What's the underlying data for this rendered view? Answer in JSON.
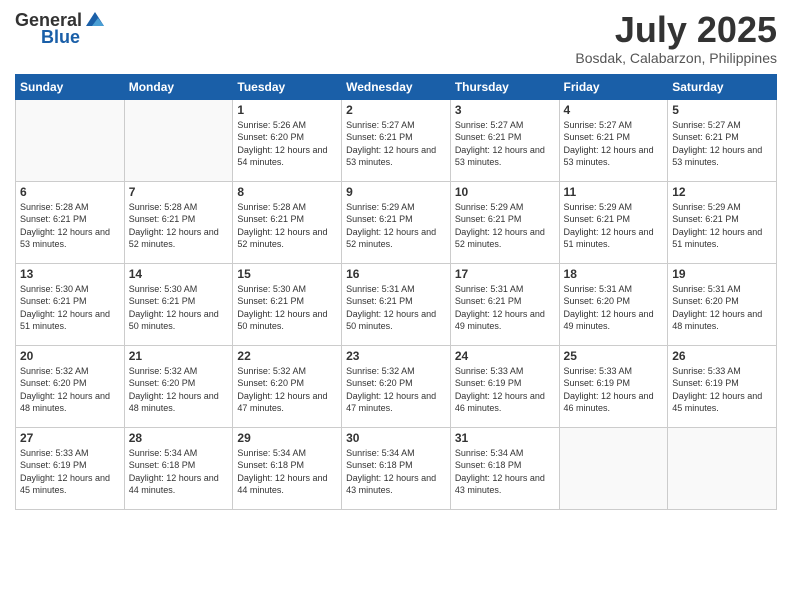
{
  "logo": {
    "general": "General",
    "blue": "Blue"
  },
  "title": "July 2025",
  "location": "Bosdak, Calabarzon, Philippines",
  "days_of_week": [
    "Sunday",
    "Monday",
    "Tuesday",
    "Wednesday",
    "Thursday",
    "Friday",
    "Saturday"
  ],
  "weeks": [
    [
      {
        "num": "",
        "info": ""
      },
      {
        "num": "",
        "info": ""
      },
      {
        "num": "1",
        "info": "Sunrise: 5:26 AM\nSunset: 6:20 PM\nDaylight: 12 hours and 54 minutes."
      },
      {
        "num": "2",
        "info": "Sunrise: 5:27 AM\nSunset: 6:21 PM\nDaylight: 12 hours and 53 minutes."
      },
      {
        "num": "3",
        "info": "Sunrise: 5:27 AM\nSunset: 6:21 PM\nDaylight: 12 hours and 53 minutes."
      },
      {
        "num": "4",
        "info": "Sunrise: 5:27 AM\nSunset: 6:21 PM\nDaylight: 12 hours and 53 minutes."
      },
      {
        "num": "5",
        "info": "Sunrise: 5:27 AM\nSunset: 6:21 PM\nDaylight: 12 hours and 53 minutes."
      }
    ],
    [
      {
        "num": "6",
        "info": "Sunrise: 5:28 AM\nSunset: 6:21 PM\nDaylight: 12 hours and 53 minutes."
      },
      {
        "num": "7",
        "info": "Sunrise: 5:28 AM\nSunset: 6:21 PM\nDaylight: 12 hours and 52 minutes."
      },
      {
        "num": "8",
        "info": "Sunrise: 5:28 AM\nSunset: 6:21 PM\nDaylight: 12 hours and 52 minutes."
      },
      {
        "num": "9",
        "info": "Sunrise: 5:29 AM\nSunset: 6:21 PM\nDaylight: 12 hours and 52 minutes."
      },
      {
        "num": "10",
        "info": "Sunrise: 5:29 AM\nSunset: 6:21 PM\nDaylight: 12 hours and 52 minutes."
      },
      {
        "num": "11",
        "info": "Sunrise: 5:29 AM\nSunset: 6:21 PM\nDaylight: 12 hours and 51 minutes."
      },
      {
        "num": "12",
        "info": "Sunrise: 5:29 AM\nSunset: 6:21 PM\nDaylight: 12 hours and 51 minutes."
      }
    ],
    [
      {
        "num": "13",
        "info": "Sunrise: 5:30 AM\nSunset: 6:21 PM\nDaylight: 12 hours and 51 minutes."
      },
      {
        "num": "14",
        "info": "Sunrise: 5:30 AM\nSunset: 6:21 PM\nDaylight: 12 hours and 50 minutes."
      },
      {
        "num": "15",
        "info": "Sunrise: 5:30 AM\nSunset: 6:21 PM\nDaylight: 12 hours and 50 minutes."
      },
      {
        "num": "16",
        "info": "Sunrise: 5:31 AM\nSunset: 6:21 PM\nDaylight: 12 hours and 50 minutes."
      },
      {
        "num": "17",
        "info": "Sunrise: 5:31 AM\nSunset: 6:21 PM\nDaylight: 12 hours and 49 minutes."
      },
      {
        "num": "18",
        "info": "Sunrise: 5:31 AM\nSunset: 6:20 PM\nDaylight: 12 hours and 49 minutes."
      },
      {
        "num": "19",
        "info": "Sunrise: 5:31 AM\nSunset: 6:20 PM\nDaylight: 12 hours and 48 minutes."
      }
    ],
    [
      {
        "num": "20",
        "info": "Sunrise: 5:32 AM\nSunset: 6:20 PM\nDaylight: 12 hours and 48 minutes."
      },
      {
        "num": "21",
        "info": "Sunrise: 5:32 AM\nSunset: 6:20 PM\nDaylight: 12 hours and 48 minutes."
      },
      {
        "num": "22",
        "info": "Sunrise: 5:32 AM\nSunset: 6:20 PM\nDaylight: 12 hours and 47 minutes."
      },
      {
        "num": "23",
        "info": "Sunrise: 5:32 AM\nSunset: 6:20 PM\nDaylight: 12 hours and 47 minutes."
      },
      {
        "num": "24",
        "info": "Sunrise: 5:33 AM\nSunset: 6:19 PM\nDaylight: 12 hours and 46 minutes."
      },
      {
        "num": "25",
        "info": "Sunrise: 5:33 AM\nSunset: 6:19 PM\nDaylight: 12 hours and 46 minutes."
      },
      {
        "num": "26",
        "info": "Sunrise: 5:33 AM\nSunset: 6:19 PM\nDaylight: 12 hours and 45 minutes."
      }
    ],
    [
      {
        "num": "27",
        "info": "Sunrise: 5:33 AM\nSunset: 6:19 PM\nDaylight: 12 hours and 45 minutes."
      },
      {
        "num": "28",
        "info": "Sunrise: 5:34 AM\nSunset: 6:18 PM\nDaylight: 12 hours and 44 minutes."
      },
      {
        "num": "29",
        "info": "Sunrise: 5:34 AM\nSunset: 6:18 PM\nDaylight: 12 hours and 44 minutes."
      },
      {
        "num": "30",
        "info": "Sunrise: 5:34 AM\nSunset: 6:18 PM\nDaylight: 12 hours and 43 minutes."
      },
      {
        "num": "31",
        "info": "Sunrise: 5:34 AM\nSunset: 6:18 PM\nDaylight: 12 hours and 43 minutes."
      },
      {
        "num": "",
        "info": ""
      },
      {
        "num": "",
        "info": ""
      }
    ]
  ]
}
